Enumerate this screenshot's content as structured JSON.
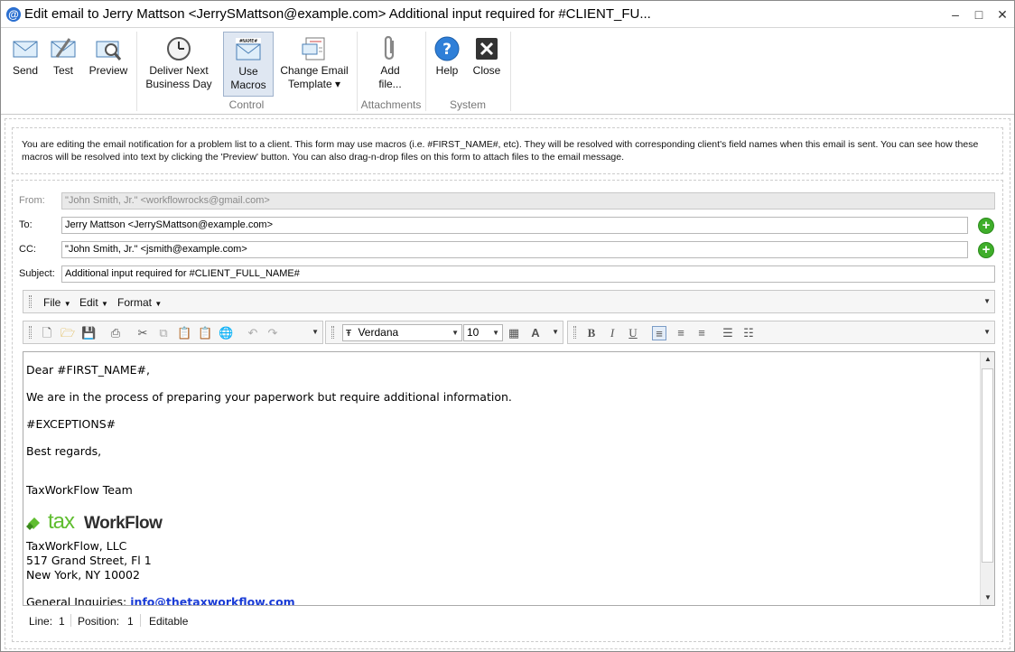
{
  "window": {
    "title": "Edit email to Jerry Mattson <JerrySMattson@example.com> Additional input required for #CLIENT_FU...",
    "app_icon": "at-sign-icon",
    "minimize": "–",
    "maximize": "□",
    "close": "✕"
  },
  "ribbon": {
    "buttons": [
      {
        "label": "Send",
        "icon": "send-envelope-icon"
      },
      {
        "label": "Test",
        "icon": "test-envelope-icon"
      },
      {
        "label": "Preview",
        "icon": "preview-magnifier-icon"
      },
      {
        "label": "Deliver Next",
        "label2": "Business Day",
        "icon": "clock-icon"
      },
      {
        "label": "Use",
        "label2": "Macros",
        "icon": "macro-envelope-icon",
        "active": true
      },
      {
        "label": "Change Email",
        "label2": "Template ▾",
        "icon": "template-icon"
      },
      {
        "label": "Add",
        "label2": "file...",
        "icon": "paperclip-icon"
      },
      {
        "label": "Help",
        "icon": "help-icon"
      },
      {
        "label": "Close",
        "icon": "close-x-icon"
      }
    ],
    "groups": {
      "control": "Control",
      "attachments": "Attachments",
      "system": "System"
    }
  },
  "info": {
    "text": "You are editing the email notification for a problem list to a client. This form may use macros (i.e. #FIRST_NAME#, etc). They will be resolved with corresponding client's field names when this email is sent. You can see how these macros will be resolved into text by clicking the 'Preview' button. You can also drag-n-drop files on this form to attach files to the email message."
  },
  "form": {
    "from_label": "From:",
    "from_value": "\"John Smith, Jr.\" <workflowrocks@gmail.com>",
    "to_label": "To:",
    "to_value": "Jerry Mattson <JerrySMattson@example.com>",
    "cc_label": "CC:",
    "cc_value": "\"John Smith, Jr.\" <jsmith@example.com>",
    "subject_label": "Subject:",
    "subject_value": "Additional input required for #CLIENT_FULL_NAME#"
  },
  "menubar": {
    "file": "File",
    "edit": "Edit",
    "format": "Format"
  },
  "toolbar": {
    "font": "Verdana",
    "size": "10"
  },
  "editor": {
    "line1": "Dear #FIRST_NAME#,",
    "line2": "We are in the process of preparing your paperwork but require additional information.",
    "line3": "#EXCEPTIONS#",
    "line4": "Best regards,",
    "line5": "TaxWorkFlow Team",
    "logo_tax": "tax",
    "logo_workflow": "WorkFlow",
    "company": "TaxWorkFlow, LLC",
    "address1": "517 Grand Street, Fl 1",
    "address2": "New York, NY 10002",
    "inquiries_label": "General Inquiries: ",
    "inquiries_email": "info@thetaxworkflow.com"
  },
  "status": {
    "line_label": "Line:",
    "line_value": "1",
    "position_label": "Position:",
    "position_value": "1",
    "mode": "Editable"
  },
  "colors": {
    "accent": "#2a6fd0",
    "add_green": "#3fae2a",
    "link": "#1a3cd6",
    "logo_green": "#5fbd2f"
  }
}
